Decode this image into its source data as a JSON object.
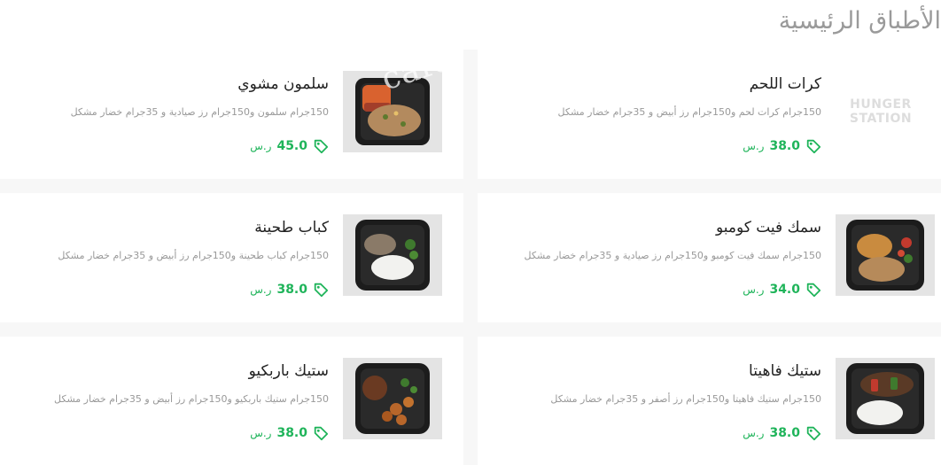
{
  "section": {
    "title": "الأطباق الرئيسية"
  },
  "watermark_text": "cafe",
  "logo": {
    "line1": "HUNGER",
    "line2": "STATION"
  },
  "colors": {
    "price": "#1fb45a",
    "title": "#9a9a9a",
    "background": "#f7f7f7"
  },
  "items": [
    {
      "name": "كرات اللحم",
      "description": "150جرام كرات لحم و150جرام رز أبيض و 35جرام خضار مشكل",
      "price": "38.0",
      "currency": "ر.س",
      "image": "hunger-station-logo"
    },
    {
      "name": "سلمون مشوي",
      "description": "150جرام سلمون و150جرام رز صيادية و 35جرام خضار مشكل",
      "price": "45.0",
      "currency": "ر.س",
      "image": "grilled-salmon-box"
    },
    {
      "name": "سمك فيت كومبو",
      "description": "150جرام سمك فيت كومبو و150جرام رز صيادية و 35جرام خضار مشكل",
      "price": "34.0",
      "currency": "ر.س",
      "image": "fish-fillet-box"
    },
    {
      "name": "كباب طحينة",
      "description": "150جرام كباب طحينة و150جرام رز أبيض و 35جرام خضار مشكل",
      "price": "38.0",
      "currency": "ر.س",
      "image": "kebab-rice-box"
    },
    {
      "name": "ستيك فاهيتا",
      "description": "150جرام ستيك فاهيتا و150جرام رز أصفر و 35جرام خضار مشكل",
      "price": "38.0",
      "currency": "ر.س",
      "image": "fajita-steak-box"
    },
    {
      "name": "ستيك باربكيو",
      "description": "150جرام ستيك باربكيو و150جرام رز أبيض و 35جرام خضار مشكل",
      "price": "38.0",
      "currency": "ر.س",
      "image": "bbq-steak-box"
    }
  ]
}
